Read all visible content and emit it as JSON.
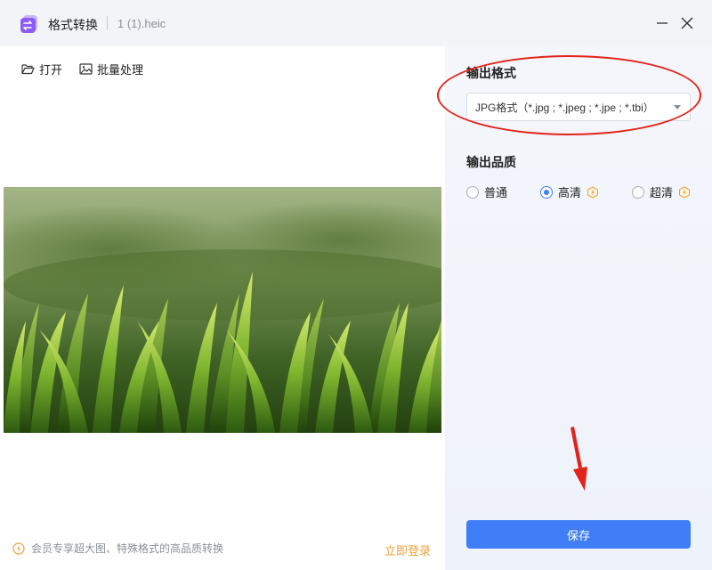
{
  "titlebar": {
    "app_title": "格式转换",
    "file_name": "1 (1).heic",
    "app_icon": "convert-app-icon",
    "minimize_icon": "minimize-icon",
    "close_icon": "close-icon"
  },
  "toolbar": {
    "open_label": "打开",
    "open_icon": "folder-open-icon",
    "batch_label": "批量处理",
    "batch_icon": "image-icon"
  },
  "footer": {
    "note": "会员专享超大图、特殊格式的高品质转换",
    "login_label": "立即登录",
    "vip_icon": "lightning-badge-icon"
  },
  "settings": {
    "format_label": "输出格式",
    "format_value": "JPG格式（*.jpg ; *.jpeg ; *.jpe ; *.tbi）",
    "quality_label": "输出品质",
    "quality_options": [
      {
        "label": "普通",
        "checked": false,
        "vip": false
      },
      {
        "label": "高清",
        "checked": true,
        "vip": true
      },
      {
        "label": "超清",
        "checked": false,
        "vip": true
      }
    ],
    "save_label": "保存"
  },
  "colors": {
    "accent": "#3f7ef6",
    "vip": "#e8a23a",
    "annotation": "#e3231a"
  }
}
